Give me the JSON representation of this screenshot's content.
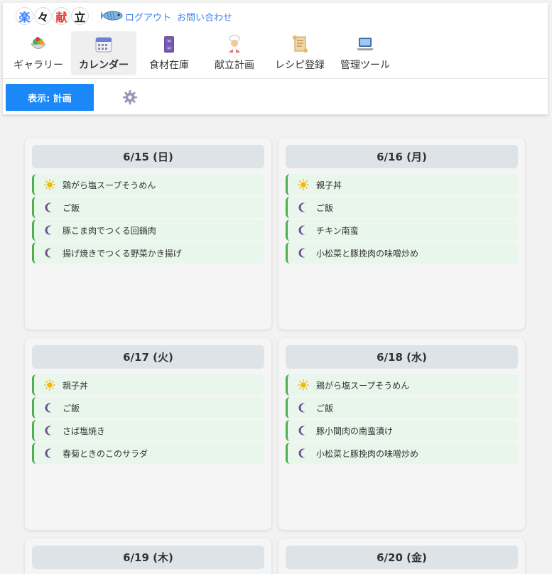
{
  "app": {
    "logo_chars": [
      "楽",
      "々",
      "献",
      "立"
    ],
    "logo_colors": [
      "#3b82f6",
      "#222222",
      "#e53935",
      "#222222"
    ],
    "links": {
      "logout": "ログアウト",
      "contact": "お問い合わせ"
    }
  },
  "nav": {
    "items": [
      {
        "label": "ギャラリー",
        "icon": "salad-bowl-icon",
        "active": false
      },
      {
        "label": "カレンダー",
        "icon": "calendar-icon",
        "active": true
      },
      {
        "label": "食材在庫",
        "icon": "cabinet-icon",
        "active": false
      },
      {
        "label": "献立計画",
        "icon": "chef-icon",
        "active": false
      },
      {
        "label": "レシピ登録",
        "icon": "scroll-icon",
        "active": false
      },
      {
        "label": "管理ツール",
        "icon": "laptop-icon",
        "active": false
      }
    ]
  },
  "toolbar": {
    "mode_label": "表示: 計画",
    "settings_icon": "gear-icon"
  },
  "colors": {
    "accent": "#1a88f7",
    "link": "#3b82f6",
    "meal_bg": "#e8f6ec",
    "meal_border": "#4caf50",
    "moon": "#6b4f8f",
    "sun": "#f5b800"
  },
  "days": [
    {
      "date": "6/15 (日)",
      "meals": [
        {
          "type": "sun",
          "name": "鶏がら塩スープそうめん"
        },
        {
          "type": "moon",
          "name": "ご飯"
        },
        {
          "type": "moon",
          "name": "豚こま肉でつくる回鍋肉"
        },
        {
          "type": "moon",
          "name": "揚げ焼きでつくる野菜かき揚げ"
        }
      ]
    },
    {
      "date": "6/16 (月)",
      "meals": [
        {
          "type": "sun",
          "name": "親子丼"
        },
        {
          "type": "moon",
          "name": "ご飯"
        },
        {
          "type": "moon",
          "name": "チキン南蛮"
        },
        {
          "type": "moon",
          "name": "小松菜と豚挽肉の味噌炒め"
        }
      ]
    },
    {
      "date": "6/17 (火)",
      "meals": [
        {
          "type": "sun",
          "name": "親子丼"
        },
        {
          "type": "moon",
          "name": "ご飯"
        },
        {
          "type": "moon",
          "name": "さば塩焼き"
        },
        {
          "type": "moon",
          "name": "春菊ときのこのサラダ"
        }
      ]
    },
    {
      "date": "6/18 (水)",
      "meals": [
        {
          "type": "sun",
          "name": "鶏がら塩スープそうめん"
        },
        {
          "type": "moon",
          "name": "ご飯"
        },
        {
          "type": "moon",
          "name": "豚小間肉の南蛮漬け"
        },
        {
          "type": "moon",
          "name": "小松菜と豚挽肉の味噌炒め"
        }
      ]
    },
    {
      "date": "6/19 (木)",
      "meals": []
    },
    {
      "date": "6/20 (金)",
      "meals": []
    }
  ]
}
